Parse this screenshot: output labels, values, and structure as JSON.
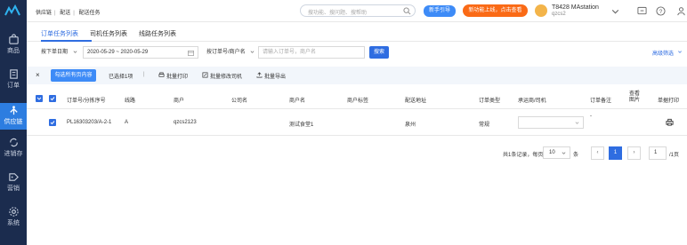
{
  "sidebar": {
    "items": [
      {
        "label": "商品",
        "icon": "bag-icon"
      },
      {
        "label": "订单",
        "icon": "document-icon"
      },
      {
        "label": "供应链",
        "icon": "share-icon",
        "active": true
      },
      {
        "label": "进销存",
        "icon": "cycle-icon"
      },
      {
        "label": "营销",
        "icon": "tag-icon"
      },
      {
        "label": "系统",
        "icon": "gear-icon"
      }
    ]
  },
  "topbar": {
    "breadcrumb": [
      "供应链",
      "配送",
      "配送任务"
    ],
    "search_placeholder": "搜功能、搜问题、搜帮助",
    "guide_label": "新手引导",
    "promo_label": "新功能上线，点击查看",
    "user_name": "T8428 MAstation",
    "user_sub": "qzcs2"
  },
  "tabs": [
    "订单任务列表",
    "司机任务列表",
    "线路任务列表"
  ],
  "filters": {
    "date_type": "按下单日期",
    "date_range": "2020-05-29 ~ 2020-05-29",
    "search_type": "按订单号/商户名",
    "search_placeholder": "请输入订单号，商户名",
    "search_button": "搜索",
    "advanced": "高级筛选"
  },
  "actions": {
    "close": "×",
    "select_all": "勾选所有页内容",
    "selected": "已选择1项",
    "divider": "|",
    "batch_print": "批量打印",
    "batch_driver": "批量修改司机",
    "batch_export": "批量导出"
  },
  "table": {
    "headers": [
      "订单号/分拣序号",
      "线路",
      "商户",
      "公司名",
      "商户名",
      "商户标签",
      "配送地址",
      "订单类型",
      "承运商/司机",
      "订单备注",
      "查看图片",
      "单据打印"
    ],
    "rows": [
      {
        "order_no": "PL16303203/A-2-1",
        "route": "A",
        "merchant": "qzcs2123",
        "company": "",
        "merchant_name": "测试食堂1",
        "tag": "",
        "address": "泉州",
        "order_type": "常规",
        "carrier": "",
        "remark": "-",
        "image": ""
      }
    ]
  },
  "pagination": {
    "summary": "共1条记录，每页",
    "page_size": "10",
    "unit": "条",
    "prev": "‹",
    "current": "1",
    "next": "›",
    "jump_value": "1",
    "total_pages": "/1页"
  },
  "colors": {
    "sidebar_bg": "#1b2c4e",
    "primary": "#2f6de1",
    "promo": "#fa6a16"
  }
}
